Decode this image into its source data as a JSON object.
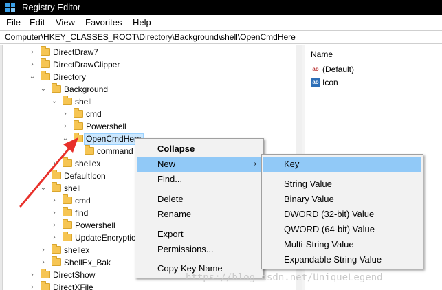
{
  "window": {
    "title": "Registry Editor",
    "titlebar_bg": "#000000"
  },
  "menu": {
    "file": "File",
    "edit": "Edit",
    "view": "View",
    "favorites": "Favorites",
    "help": "Help"
  },
  "address": {
    "path": "Computer\\HKEY_CLASSES_ROOT\\Directory\\Background\\shell\\OpenCmdHere"
  },
  "tree": {
    "rows": [
      {
        "label": "DirectDraw7",
        "chevron": "›"
      },
      {
        "label": "DirectDrawClipper",
        "chevron": "›"
      },
      {
        "label": "Directory",
        "chevron": "⌄"
      },
      {
        "label": "Background",
        "chevron": "⌄"
      },
      {
        "label": "shell",
        "chevron": "⌄"
      },
      {
        "label": "cmd",
        "chevron": "›"
      },
      {
        "label": "Powershell",
        "chevron": "›"
      },
      {
        "label": "OpenCmdHere",
        "chevron": "⌄"
      },
      {
        "label": "command",
        "chevron": ""
      },
      {
        "label": "shellex",
        "chevron": "›"
      },
      {
        "label": "DefaultIcon",
        "chevron": ""
      },
      {
        "label": "shell",
        "chevron": "⌄"
      },
      {
        "label": "cmd",
        "chevron": "›"
      },
      {
        "label": "find",
        "chevron": "›"
      },
      {
        "label": "Powershell",
        "chevron": "›"
      },
      {
        "label": "UpdateEncryptio",
        "chevron": "›"
      },
      {
        "label": "shellex",
        "chevron": "›"
      },
      {
        "label": "ShellEx_Bak",
        "chevron": "›"
      },
      {
        "label": "DirectShow",
        "chevron": "›"
      },
      {
        "label": "DirectXFile",
        "chevron": "›"
      }
    ],
    "selection_color": "#cce8ff"
  },
  "values": {
    "header_name": "Name",
    "items": [
      {
        "icon": "string-value-icon",
        "label": "(Default)",
        "glyph": "ab"
      },
      {
        "icon": "binary-value-icon",
        "label": "Icon",
        "glyph": "ab"
      }
    ]
  },
  "context_menu": {
    "collapse": "Collapse",
    "new": "New",
    "find": "Find...",
    "delete": "Delete",
    "rename": "Rename",
    "export": "Export",
    "permissions": "Permissions...",
    "copy_key_name": "Copy Key Name",
    "submenu_arrow": "›",
    "highlight_color": "#91c9f7"
  },
  "submenu": {
    "key": "Key",
    "string_value": "String Value",
    "binary_value": "Binary Value",
    "dword_value": "DWORD (32-bit) Value",
    "qword_value": "QWORD (64-bit) Value",
    "multi_string_value": "Multi-String Value",
    "expandable_string_value": "Expandable String Value"
  },
  "annotation": {
    "arrow_color": "#e8302a"
  },
  "watermark": {
    "text": "https://blog.csdn.net/UniqueLegend"
  }
}
